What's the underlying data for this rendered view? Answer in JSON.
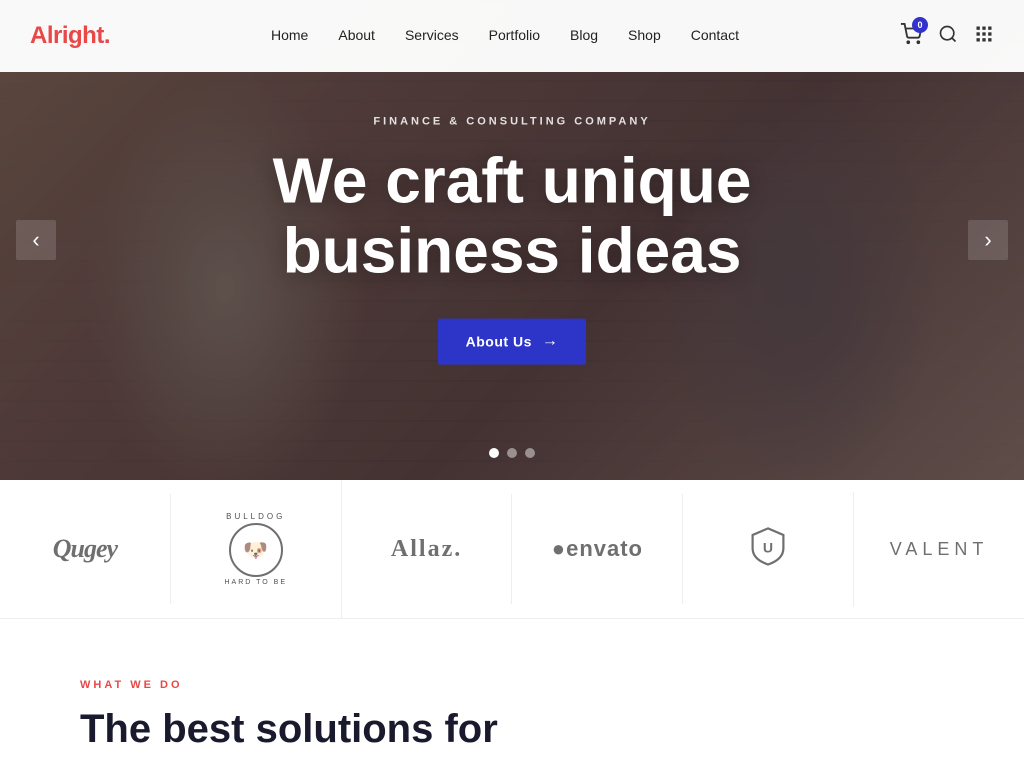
{
  "brand": {
    "name": "Alright",
    "dot": "."
  },
  "navbar": {
    "items": [
      {
        "label": "Home",
        "href": "#"
      },
      {
        "label": "About",
        "href": "#"
      },
      {
        "label": "Services",
        "href": "#"
      },
      {
        "label": "Portfolio",
        "href": "#"
      },
      {
        "label": "Blog",
        "href": "#"
      },
      {
        "label": "Shop",
        "href": "#"
      },
      {
        "label": "Contact",
        "href": "#"
      }
    ],
    "cart_count": "0"
  },
  "hero": {
    "subtitle": "Finance & Consulting Company",
    "title_line1": "We craft unique",
    "title_line2": "business ideas",
    "cta_label": "About Us",
    "dots": [
      {
        "active": true
      },
      {
        "active": false
      },
      {
        "active": false
      }
    ]
  },
  "brands": [
    {
      "name": "Qugey",
      "type": "text"
    },
    {
      "name": "BULLDOG",
      "type": "bulldog"
    },
    {
      "name": "Allaz.",
      "type": "text"
    },
    {
      "name": "●envato",
      "type": "text"
    },
    {
      "name": "shield",
      "type": "shield"
    },
    {
      "name": "VALENT",
      "type": "thin"
    }
  ],
  "what_we_do": {
    "label": "What We Do",
    "title_line1": "The best solutions for"
  }
}
